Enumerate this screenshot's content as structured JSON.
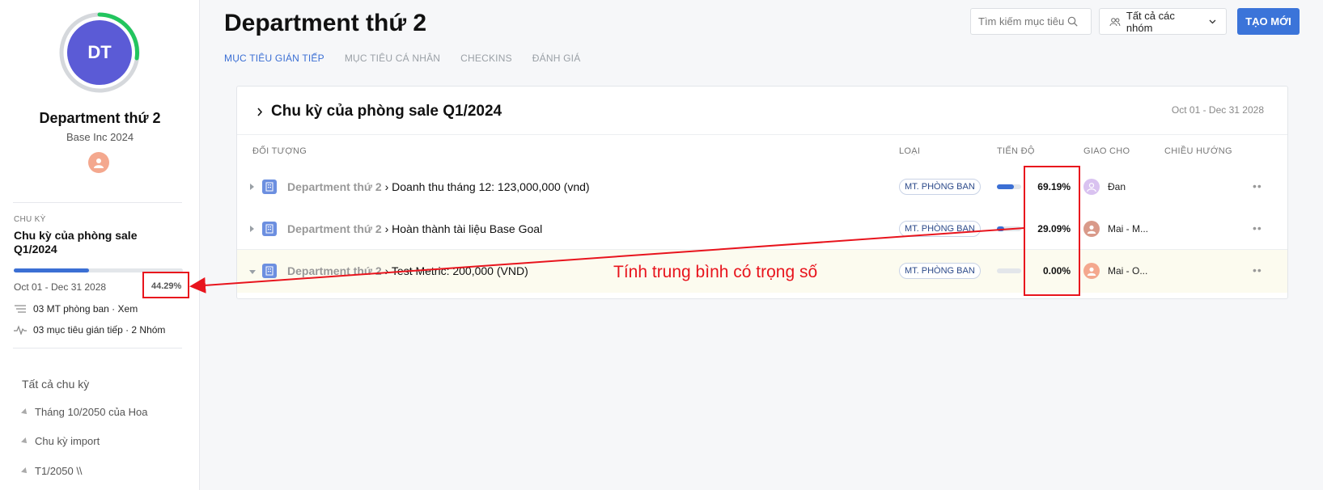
{
  "sidebar": {
    "avatar_initials": "DT",
    "dept_name": "Department thứ 2",
    "dept_sub": "Base Inc 2024",
    "cycle_label": "CHU KỲ",
    "cycle_name": "Chu kỳ của phòng sale Q1/2024",
    "cycle_progress": 0.4429,
    "cycle_dates": "Oct 01 - Dec 31 2028",
    "cycle_pct": "44.29%",
    "meta": [
      {
        "icon": "list-icon",
        "text": "03 MT phòng ban · Xem"
      },
      {
        "icon": "activity-icon",
        "text": "03 mục tiêu gián tiếp · 2 Nhóm"
      }
    ],
    "all_cycles": "Tất cả chu kỳ",
    "tree": [
      {
        "label": "Tháng 10/2050 của Hoa"
      },
      {
        "label": "Chu kỳ import"
      },
      {
        "label": "T1/2050 \\\\"
      }
    ]
  },
  "header": {
    "title": "Department thứ 2",
    "tabs": [
      "MỤC TIÊU GIÁN TIẾP",
      "MỤC TIÊU CÁ NHÂN",
      "CHECKINS",
      "ĐÁNH GIÁ"
    ],
    "search_placeholder": "Tìm kiếm mục tiêu",
    "group_select": "Tất cả các nhóm",
    "create_button": "TẠO MỚI"
  },
  "card": {
    "title": "Chu kỳ của phòng sale Q1/2024",
    "dates": "Oct 01 - Dec 31 2028",
    "columns": [
      "ĐỐI TƯỢNG",
      "LOẠI",
      "TIẾN ĐỘ",
      "GIAO CHO",
      "CHIỀU HƯỚNG"
    ],
    "rows": [
      {
        "parent": "Department thứ 2",
        "child": " › Doanh thu tháng 12: 123,000,000 (vnd)",
        "type": "MT. PHÒNG BAN",
        "progress": 0.6919,
        "pct": "69.19%",
        "assignee": "Đan",
        "avatar_color": "#c9a6e8"
      },
      {
        "parent": "Department thứ 2",
        "child": " › Hoàn thành tài liệu Base Goal",
        "type": "MT. PHÒNG BAN",
        "progress": 0.2909,
        "pct": "29.09%",
        "assignee": "Mai - M...",
        "avatar_color": "#d99a8a"
      },
      {
        "parent": "Department thứ 2",
        "child": " › Test Metric: 200,000 (VND)",
        "type": "MT. PHÒNG BAN",
        "progress": 0,
        "pct": "0.00%",
        "assignee": "Mai - O...",
        "avatar_color": "#f4a88e"
      }
    ]
  },
  "annotation": {
    "text": "Tính trung bình có trọng số",
    "color": "#e8141d"
  },
  "colors": {
    "accent": "#3b6fd4",
    "avatar_bg": "#5b5bd6",
    "ring": "#22c55e"
  }
}
